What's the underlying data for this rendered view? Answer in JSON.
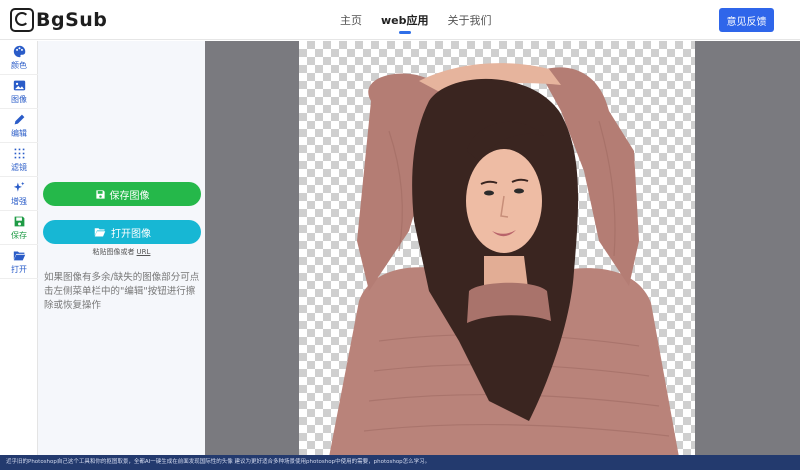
{
  "app": {
    "logo_text": "BgSub"
  },
  "nav": {
    "items": [
      {
        "label": "主页",
        "active": false
      },
      {
        "label": "web应用",
        "active": true
      },
      {
        "label": "关于我们",
        "active": false
      }
    ],
    "feedback_label": "意见反馈"
  },
  "rail": {
    "items": [
      {
        "label": "颜色",
        "icon": "palette-icon"
      },
      {
        "label": "图像",
        "icon": "image-icon"
      },
      {
        "label": "编辑",
        "icon": "pencil-icon"
      },
      {
        "label": "滤镜",
        "icon": "filter-icon"
      },
      {
        "label": "增强",
        "icon": "sparkle-icon"
      },
      {
        "label": "保存",
        "icon": "floppy-icon"
      },
      {
        "label": "打开",
        "icon": "folder-open-icon"
      }
    ]
  },
  "panel": {
    "save_label": "保存图像",
    "open_label": "打开图像",
    "paste_hint": "粘贴图像或者",
    "paste_url": "URL",
    "help_text": "如果图像有多余/缺失的图像部分可点击左侧菜单栏中的\"编辑\"按钮进行擦除或恢复操作"
  },
  "bottom_strip": {
    "text": "近乎旧的Photoshop自己这个工具和你的抠图取景，全都AI一键生成在前面发现国际性的头像 建议为更好适合多种场景使用photoshop中使用的需要，photoshop怎么学习。"
  },
  "colors": {
    "accent": "#2f66ea",
    "save_green": "#25b84a",
    "open_cyan": "#17b7d4",
    "canvas_bg": "#7a7a7f"
  }
}
